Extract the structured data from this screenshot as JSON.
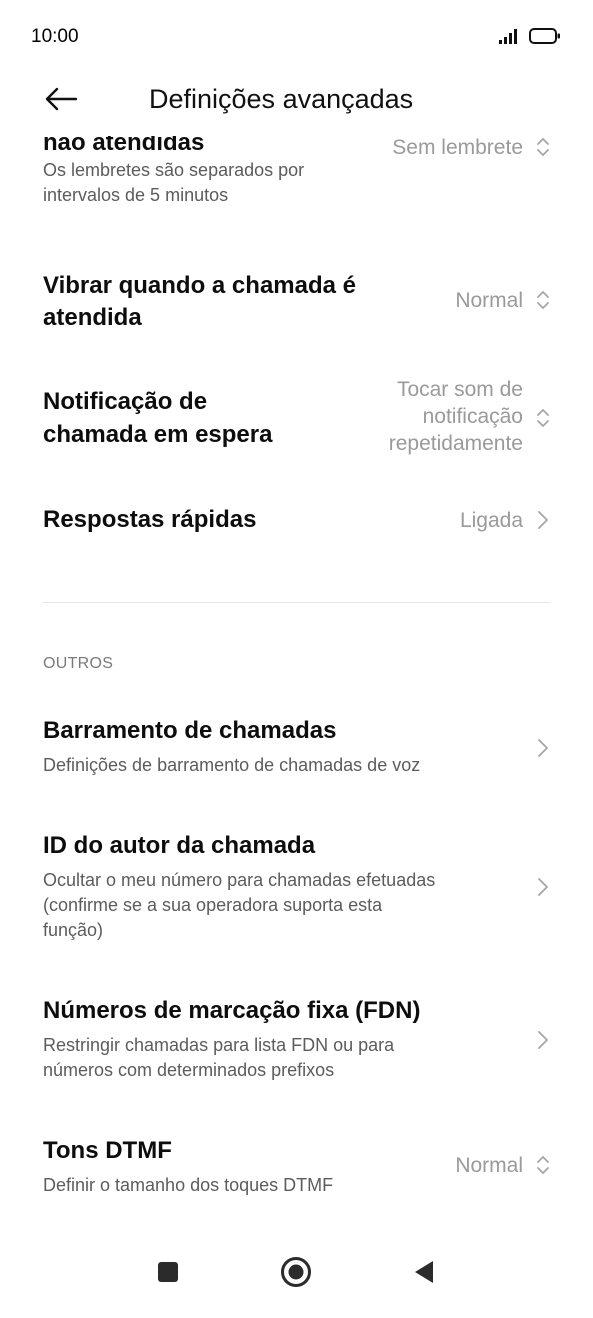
{
  "status_bar": {
    "time": "10:00",
    "icons": [
      "signal-icon",
      "battery-icon"
    ]
  },
  "header": {
    "title": "Definições avançadas",
    "back_icon": "back-arrow-icon"
  },
  "settings": [
    {
      "title_line1": "não atendidas",
      "subtitle_line1": "Os lembretes são separados por",
      "subtitle_line2": "intervalos de 5 minutos",
      "value_line1": "Sem lembrete",
      "indicator": "updown-icon"
    },
    {
      "title_line1": "Vibrar quando a chamada é",
      "title_line2": "atendida",
      "value_line1": "Normal",
      "indicator": "updown-icon"
    },
    {
      "title_line1": "Notificação de",
      "title_line2": "chamada em espera",
      "value_line1": "Tocar som de",
      "value_line2": "notificação",
      "value_line3": "repetidamente",
      "indicator": "updown-icon"
    },
    {
      "title_line1": "Respostas rápidas",
      "value_line1": "Ligada",
      "indicator": "chevron-right-icon"
    }
  ],
  "section_outros": {
    "label": "OUTROS",
    "items": [
      {
        "title_line1": "Barramento de chamadas",
        "subtitle_line1": "Definições de barramento de chamadas de voz",
        "indicator": "chevron-right-icon"
      },
      {
        "title_line1": "ID do autor da chamada",
        "subtitle_line1": "Ocultar o meu número para chamadas efetuadas",
        "subtitle_line2": "(confirme se a sua operadora suporta esta",
        "subtitle_line3": "função)",
        "indicator": "chevron-right-icon"
      },
      {
        "title_line1": "Números de marcação fixa (FDN)",
        "subtitle_line1": "Restringir chamadas para lista FDN ou para",
        "subtitle_line2": "números com determinados prefixos",
        "indicator": "chevron-right-icon"
      },
      {
        "title_line1": "Tons DTMF",
        "subtitle_line1": "Definir o tamanho dos toques DTMF",
        "value_line1": "Normal",
        "indicator": "updown-icon"
      }
    ]
  },
  "navbar": {
    "buttons": [
      "recents-square-icon",
      "home-circle-icon",
      "back-triangle-icon"
    ]
  },
  "colors": {
    "title_text": "#0d0d0d",
    "subtitle_text": "#5c5c5c",
    "value_text": "#9a9a9a",
    "divider": "#e6e6e6",
    "section_label": "#7a7a7a"
  }
}
